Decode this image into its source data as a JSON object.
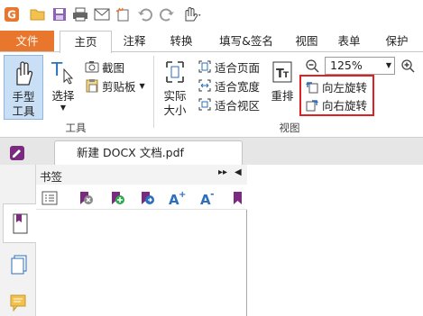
{
  "quick_access": {
    "icons": [
      "app-logo-icon",
      "open-folder-icon",
      "save-icon",
      "print-icon",
      "email-icon",
      "new-icon",
      "undo-icon",
      "redo-icon",
      "hand-dropdown-icon"
    ]
  },
  "tabs": [
    {
      "label": "文件",
      "key": "file"
    },
    {
      "label": "主页",
      "key": "home"
    },
    {
      "label": "注释",
      "key": "comment"
    },
    {
      "label": "转换",
      "key": "convert"
    },
    {
      "label": "填写&签名",
      "key": "fill-sign"
    },
    {
      "label": "视图",
      "key": "view"
    },
    {
      "label": "表单",
      "key": "form"
    },
    {
      "label": "保护",
      "key": "protect"
    }
  ],
  "ribbon": {
    "hand_tool_line1": "手型",
    "hand_tool_line2": "工具",
    "select_label": "选择",
    "screenshot_label": "截图",
    "clipboard_label": "剪贴板",
    "tools_group_label": "工具",
    "actual_size_line1": "实际",
    "actual_size_line2": "大小",
    "fit_page_label": "适合页面",
    "fit_width_label": "适合宽度",
    "fit_visible_label": "适合视区",
    "reflow_label": "重排",
    "zoom_value": "125%",
    "rotate_left_label": "向左旋转",
    "rotate_right_label": "向右旋转",
    "view_group_label": "视图",
    "highlight_color": "#e02020"
  },
  "document_tab": {
    "title": "新建 DOCX 文档.pdf"
  },
  "bookmarks_panel": {
    "title": "书签",
    "tools": [
      "bookmark-options-icon",
      "delete-bookmark-icon",
      "add-bookmark-icon",
      "add-child-bookmark-icon",
      "expand-bookmark-icon",
      "increase-font-icon",
      "decrease-font-icon",
      "bookmark-more-icon"
    ]
  },
  "colors": {
    "file_tab": "#e8762c",
    "accent_blue": "#2b6fbd",
    "bookmark_purple": "#7a2a7f"
  }
}
